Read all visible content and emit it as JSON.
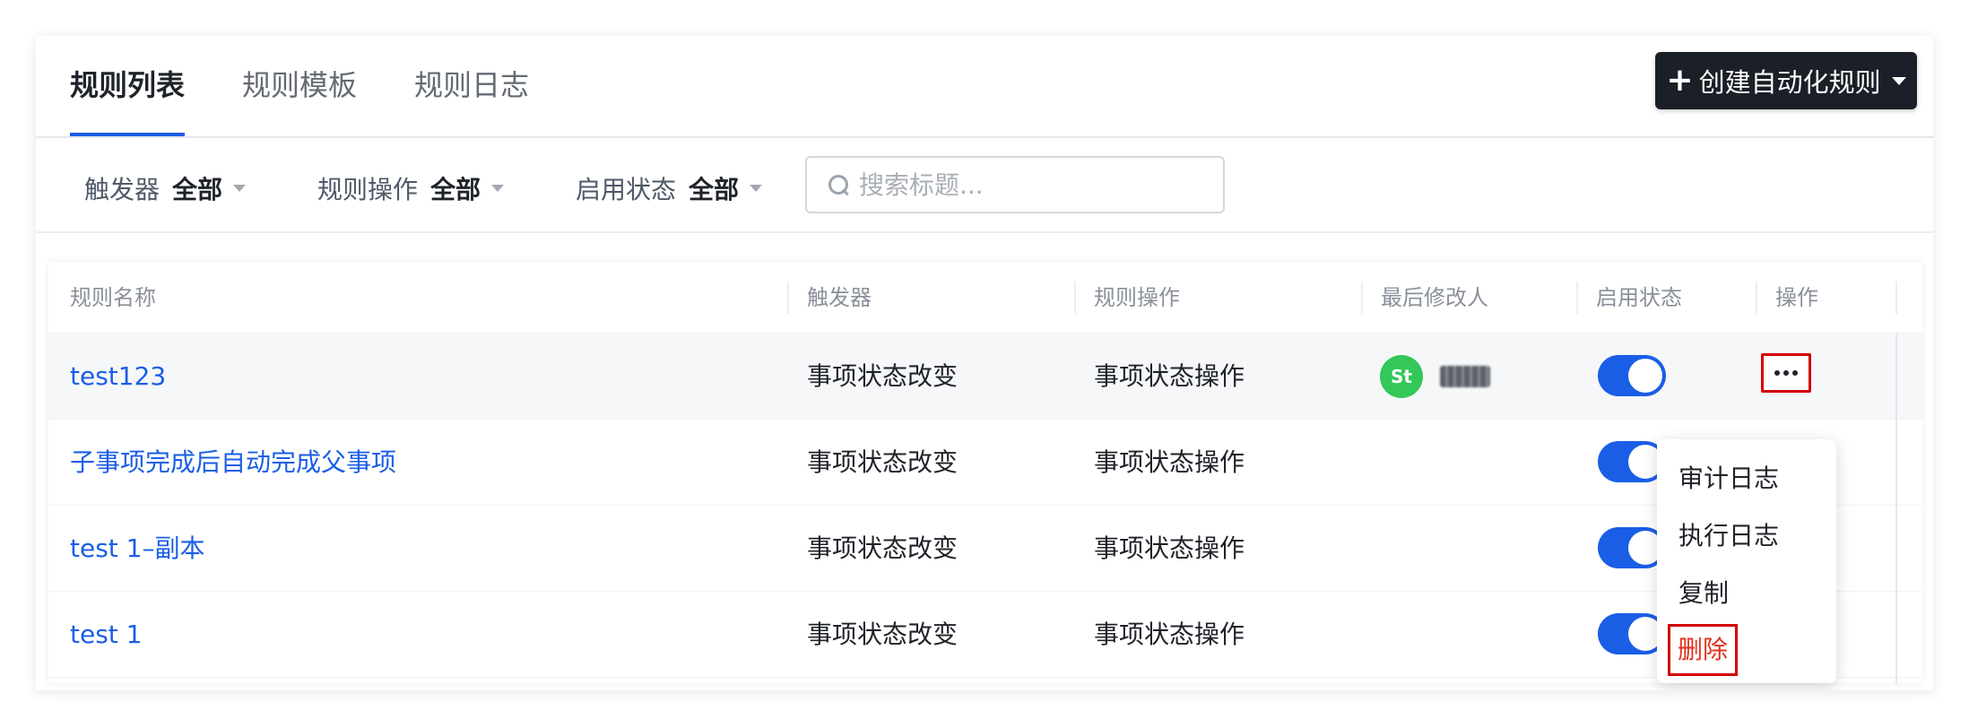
{
  "tabs": [
    {
      "label": "规则列表",
      "active": true
    },
    {
      "label": "规则模板",
      "active": false
    },
    {
      "label": "规则日志",
      "active": false
    }
  ],
  "create_button": {
    "label": "创建自动化规则",
    "icon": "plus-icon"
  },
  "filters": [
    {
      "label": "触发器",
      "value": "全部"
    },
    {
      "label": "规则操作",
      "value": "全部"
    },
    {
      "label": "启用状态",
      "value": "全部"
    }
  ],
  "search": {
    "placeholder": "搜索标题...",
    "value": ""
  },
  "table": {
    "columns": [
      "规则名称",
      "触发器",
      "规则操作",
      "最后修改人",
      "启用状态",
      "操作"
    ],
    "rows": [
      {
        "name": "test123",
        "trigger": "事项状态改变",
        "action": "事项状态操作",
        "modifier_initials": "St",
        "enabled": true
      },
      {
        "name": "子事项完成后自动完成父事项",
        "trigger": "事项状态改变",
        "action": "事项状态操作",
        "enabled": true
      },
      {
        "name": "test 1–副本",
        "trigger": "事项状态改变",
        "action": "事项状态操作",
        "enabled": true
      },
      {
        "name": "test 1",
        "trigger": "事项状态改变",
        "action": "事项状态操作",
        "enabled": true
      }
    ]
  },
  "more_menu": {
    "items": [
      "审计日志",
      "执行日志",
      "复制"
    ],
    "danger_item": "删除"
  },
  "colors": {
    "accent": "#1a5ee6",
    "primary_button": "#1b1f27",
    "avatar": "#34c759",
    "danger": "#e0301e",
    "highlight_box": "#d40000"
  }
}
